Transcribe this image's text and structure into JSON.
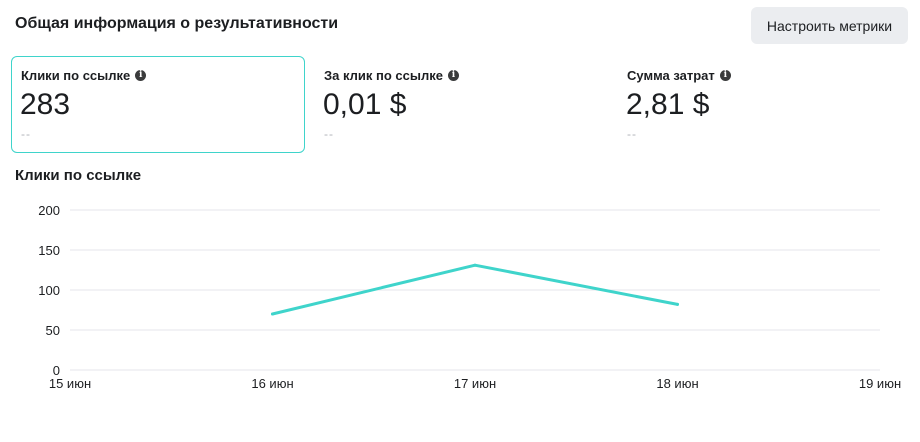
{
  "header": {
    "title": "Общая информация о результативности",
    "button_label": "Настроить метрики"
  },
  "cards": [
    {
      "label": "Клики по ссылке",
      "value": "283",
      "compare": "--"
    },
    {
      "label": "За клик по ссылке",
      "value": "0,01 $",
      "compare": "--"
    },
    {
      "label": "Сумма затрат",
      "value": "2,81 $",
      "compare": "--"
    }
  ],
  "chart_title": "Клики по ссылке",
  "colors": {
    "accent": "#3fd4cb",
    "grid": "#e4e6eb",
    "text": "#1c1e21"
  },
  "chart_data": {
    "type": "line",
    "categories": [
      "15 июн",
      "16 июн",
      "17 июн",
      "18 июн",
      "19 июн"
    ],
    "yticks": [
      "0",
      "50",
      "100",
      "150",
      "200"
    ],
    "ylim": [
      0,
      200
    ],
    "series": [
      {
        "values": [
          null,
          70,
          131,
          82,
          null
        ]
      }
    ],
    "grid": true
  }
}
